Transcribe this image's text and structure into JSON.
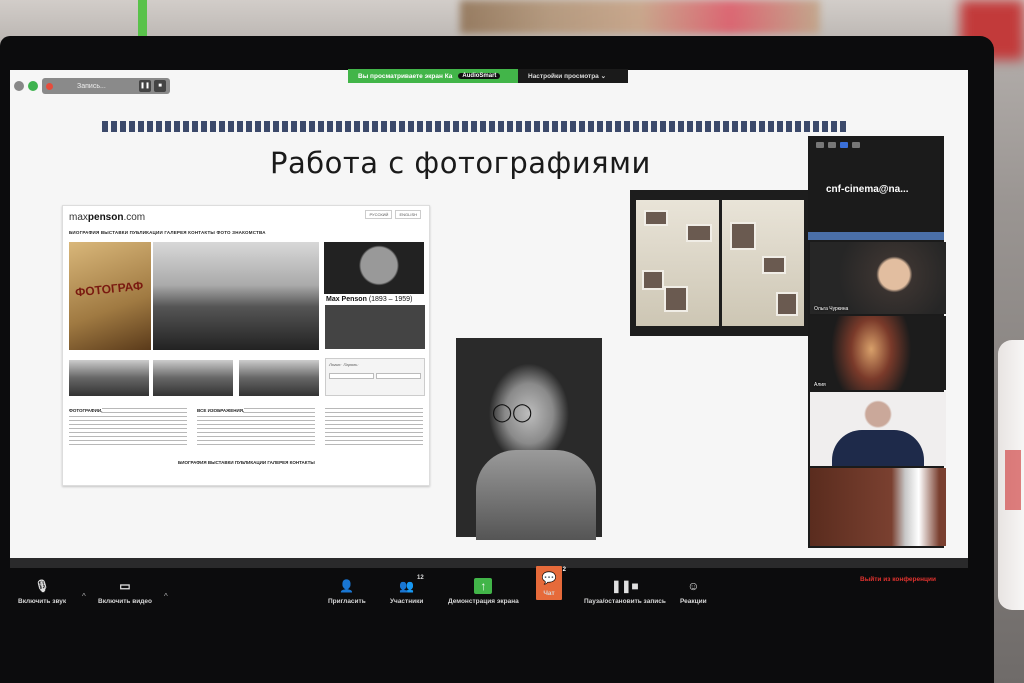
{
  "zoom_top": {
    "recording_label": "Запись...",
    "share_banner_text": "Вы просматриваете экран Ка",
    "share_banner_user": "AudioSmart",
    "view_options": "Настройки просмотра ⌄"
  },
  "slide": {
    "title": "Работа с фотографиями"
  },
  "website": {
    "logo_prefix": "max",
    "logo_name": "penson",
    "logo_suffix": ".com",
    "lang": [
      "РУССКИЙ",
      "ENGLISH"
    ],
    "nav": "БИОГРАФИЯ  ВЫСТАВКИ  ПУБЛИКАЦИИ  ГАЛЕРЕЯ  КОНТАКТЫ  ФОТО  ЗНАКОМСТВА",
    "poster_text": "ФОТОГРАФ",
    "person_name": "Max Penson",
    "person_years": "(1893 – 1959)",
    "col1_head": "ФОТОГРАФИИ,",
    "col2_head": "ВСЕ ИЗОБРАЖЕНИЯ,",
    "footer_nav": "БИОГРАФИЯ  ВЫСТАВКИ  ПУБЛИКАЦИИ  ГАЛЕРЕЯ  КОНТАКТЫ",
    "login_label": "Логин:",
    "password_label": "Пароль:"
  },
  "participants": {
    "host_name": "cnf-cinema@na...",
    "tiles": [
      {
        "label": "Ольга Чуркина"
      },
      {
        "label": "Алия"
      },
      {
        "label": ""
      },
      {
        "label": ""
      }
    ]
  },
  "toolbar": {
    "mute_label": "Включить звук",
    "video_label": "Включить видео",
    "invite_label": "Пригласить",
    "participants_label": "Участники",
    "participants_count": "12",
    "share_label": "Демонстрация экрана",
    "chat_label": "Чат",
    "chat_count": "2",
    "record_label": "Пауза/остановить запись",
    "reactions_label": "Реакции",
    "leave_label": "Выйти из конференции"
  },
  "colors": {
    "share_green": "#42b549",
    "chat_orange": "#e66a3a",
    "leave_red": "#e0322e",
    "stripe_navy": "#3c4a6b"
  }
}
